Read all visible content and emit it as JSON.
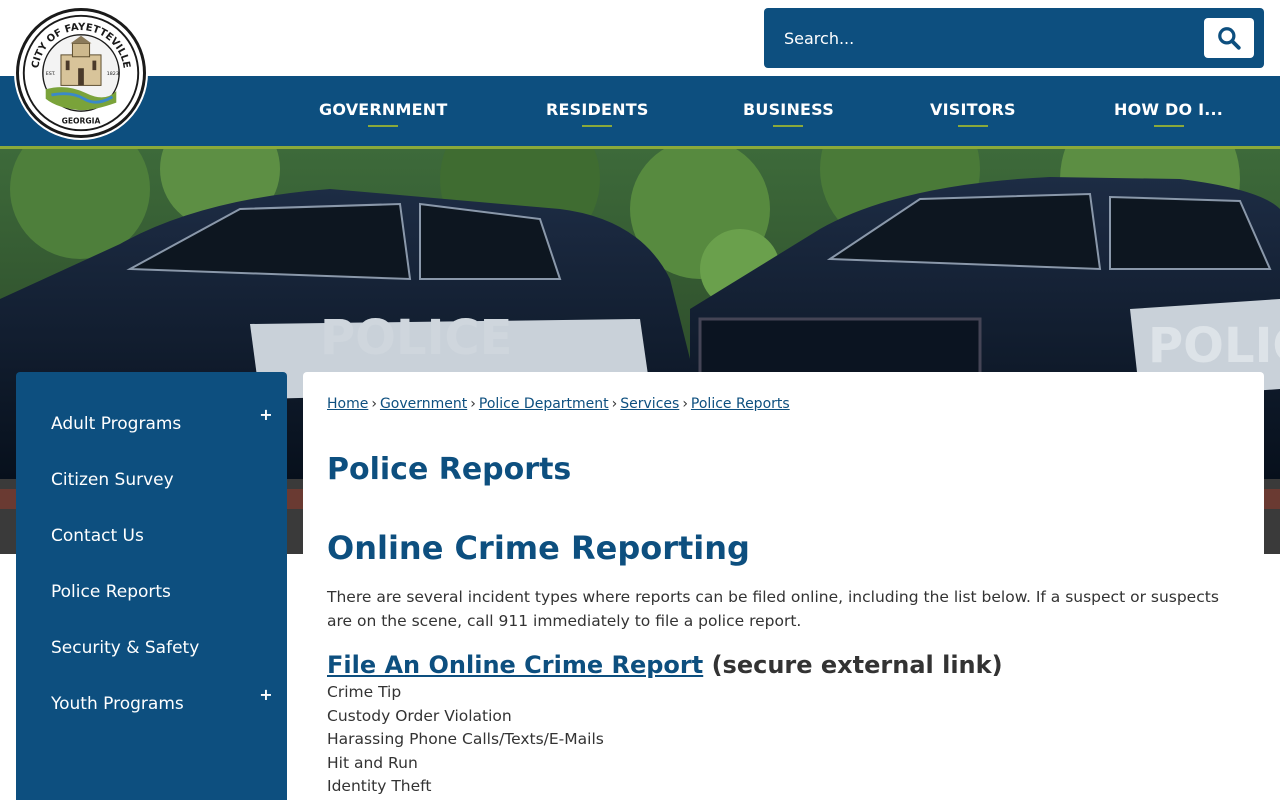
{
  "header": {
    "logo": {
      "top_text": "CITY OF FAYETTEVILLE",
      "bottom_text": "GEORGIA",
      "est_text": "EST.",
      "year_text": "1823"
    },
    "search": {
      "placeholder": "Search..."
    },
    "nav": [
      {
        "label": "GOVERNMENT"
      },
      {
        "label": "RESIDENTS"
      },
      {
        "label": "BUSINESS"
      },
      {
        "label": "VISITORS"
      },
      {
        "label": "HOW DO I..."
      }
    ]
  },
  "hero": {
    "vehicle_text": "POLICE"
  },
  "sidebar": {
    "items": [
      {
        "label": "Adult Programs",
        "expandable": true
      },
      {
        "label": "Citizen Survey",
        "expandable": false
      },
      {
        "label": "Contact Us",
        "expandable": false
      },
      {
        "label": "Police Reports",
        "expandable": false
      },
      {
        "label": "Security & Safety",
        "expandable": false
      },
      {
        "label": "Youth Programs",
        "expandable": true
      }
    ]
  },
  "main": {
    "breadcrumb": [
      "Home",
      "Government",
      "Police Department",
      "Services",
      "Police Reports"
    ],
    "breadcrumb_sep": "›",
    "page_title": "Police Reports",
    "section_title": "Online Crime Reporting",
    "intro": "There are several incident types where reports can be filed online, including the list below. If a suspect or suspects are on the scene, call 911 immediately to file a police report.",
    "report_link": "File An Online Crime Report",
    "report_note": "(secure external link)",
    "incident_types": [
      "Crime Tip",
      "Custody Order Violation",
      "Harassing Phone Calls/Texts/E-Mails",
      "Hit and Run",
      "Identity Theft"
    ]
  },
  "colors": {
    "primary": "#0d4f7f",
    "accent": "#8aa93a",
    "text": "#333333"
  },
  "icons": {
    "search": "search-icon",
    "expand": "plus-icon"
  }
}
